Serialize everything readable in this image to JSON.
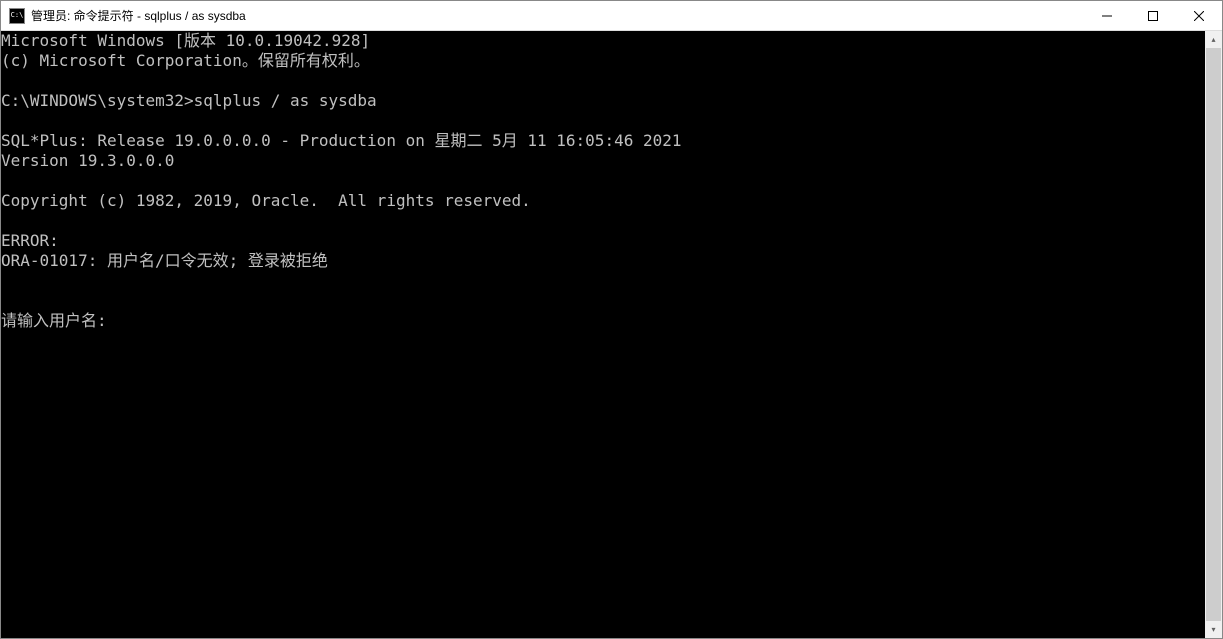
{
  "window": {
    "title": "管理员: 命令提示符 - sqlplus  / as sysdba",
    "icon_text": "C:\\"
  },
  "terminal": {
    "lines": [
      "Microsoft Windows [版本 10.0.19042.928]",
      "(c) Microsoft Corporation。保留所有权利。",
      "",
      "C:\\WINDOWS\\system32>sqlplus / as sysdba",
      "",
      "SQL*Plus: Release 19.0.0.0.0 - Production on 星期二 5月 11 16:05:46 2021",
      "Version 19.3.0.0.0",
      "",
      "Copyright (c) 1982, 2019, Oracle.  All rights reserved.",
      "",
      "ERROR:",
      "ORA-01017: 用户名/口令无效; 登录被拒绝",
      "",
      "",
      "请输入用户名:"
    ]
  }
}
